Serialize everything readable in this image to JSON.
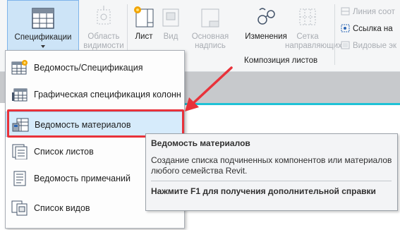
{
  "ribbon": {
    "buttons": {
      "schedules": "Спецификации",
      "scope_box": "Область видимости",
      "sheet": "Лист",
      "view": "Вид",
      "title_block": "Основная надпись",
      "revisions": "Изменения",
      "guide_grid": "Сетка направляющих",
      "matchline": "Линия соот",
      "view_reference": "Ссылка на",
      "viewports": "Видовые эк"
    },
    "panel_label": "Композиция листов"
  },
  "menu": {
    "items": [
      {
        "label": "Ведомость/Спецификация",
        "icon": "schedule-quantities-icon"
      },
      {
        "label": "Графическая спецификация колонн",
        "icon": "graphical-column-schedule-icon"
      },
      {
        "label": "Ведомость материалов",
        "icon": "material-takeoff-icon"
      },
      {
        "label": "Список листов",
        "icon": "sheet-list-icon"
      },
      {
        "label": "Ведомость примечаний",
        "icon": "note-block-icon"
      },
      {
        "label": "Список видов",
        "icon": "view-list-icon"
      }
    ]
  },
  "tooltip": {
    "title": "Ведомость материалов",
    "body": "Создание списка подчиненных компонентов или материалов любого семейства Revit.",
    "help": "Нажмите F1 для получения дополнительной справки"
  },
  "colors": {
    "highlight_red": "#e8323a",
    "hover_bg": "#d6ebfb",
    "accent_cyan": "#1fc2d6"
  }
}
